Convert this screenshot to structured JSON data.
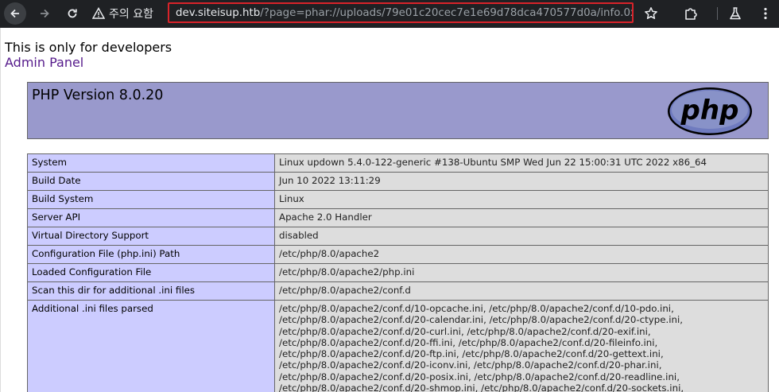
{
  "browser": {
    "security_label": "주의 요함",
    "url_host": "dev.siteisup.htb",
    "url_path": "/?page=phar://uploads/79e01c20cec7e1e69d78dca470577d0a/info.0xdf/info"
  },
  "page": {
    "dev_message": "This is only for developers",
    "admin_link": "Admin Panel",
    "php_version_title": "PHP Version 8.0.20",
    "php_logo_text": "php"
  },
  "info_rows": [
    {
      "key": "System",
      "value": "Linux updown 5.4.0-122-generic #138-Ubuntu SMP Wed Jun 22 15:00:31 UTC 2022 x86_64"
    },
    {
      "key": "Build Date",
      "value": "Jun 10 2022 13:11:29"
    },
    {
      "key": "Build System",
      "value": "Linux"
    },
    {
      "key": "Server API",
      "value": "Apache 2.0 Handler"
    },
    {
      "key": "Virtual Directory Support",
      "value": "disabled"
    },
    {
      "key": "Configuration File (php.ini) Path",
      "value": "/etc/php/8.0/apache2"
    },
    {
      "key": "Loaded Configuration File",
      "value": "/etc/php/8.0/apache2/php.ini"
    },
    {
      "key": "Scan this dir for additional .ini files",
      "value": "/etc/php/8.0/apache2/conf.d"
    }
  ],
  "additional_ini": {
    "key": "Additional .ini files parsed",
    "lines": [
      "/etc/php/8.0/apache2/conf.d/10-opcache.ini, /etc/php/8.0/apache2/conf.d/10-pdo.ini,",
      "/etc/php/8.0/apache2/conf.d/20-calendar.ini, /etc/php/8.0/apache2/conf.d/20-ctype.ini,",
      "/etc/php/8.0/apache2/conf.d/20-curl.ini, /etc/php/8.0/apache2/conf.d/20-exif.ini,",
      "/etc/php/8.0/apache2/conf.d/20-ffi.ini, /etc/php/8.0/apache2/conf.d/20-fileinfo.ini,",
      "/etc/php/8.0/apache2/conf.d/20-ftp.ini, /etc/php/8.0/apache2/conf.d/20-gettext.ini,",
      "/etc/php/8.0/apache2/conf.d/20-iconv.ini, /etc/php/8.0/apache2/conf.d/20-phar.ini,",
      "/etc/php/8.0/apache2/conf.d/20-posix.ini, /etc/php/8.0/apache2/conf.d/20-readline.ini,",
      "/etc/php/8.0/apache2/conf.d/20-shmop.ini, /etc/php/8.0/apache2/conf.d/20-sockets.ini,"
    ]
  },
  "icons": {
    "back": "arrow-left-icon",
    "forward": "arrow-right-icon",
    "reload": "reload-icon",
    "warning": "warning-triangle-icon",
    "bookmark": "star-icon",
    "extensions": "puzzle-icon",
    "labs": "flask-icon",
    "menu": "kebab-menu-icon"
  },
  "colors": {
    "chrome_bg": "#1f2124",
    "url_highlight_border": "#d9232a",
    "php_header_bg": "#9999cc",
    "key_cell_bg": "#ccccff",
    "value_cell_bg": "#dddddd",
    "link_visited": "#551a8b"
  }
}
